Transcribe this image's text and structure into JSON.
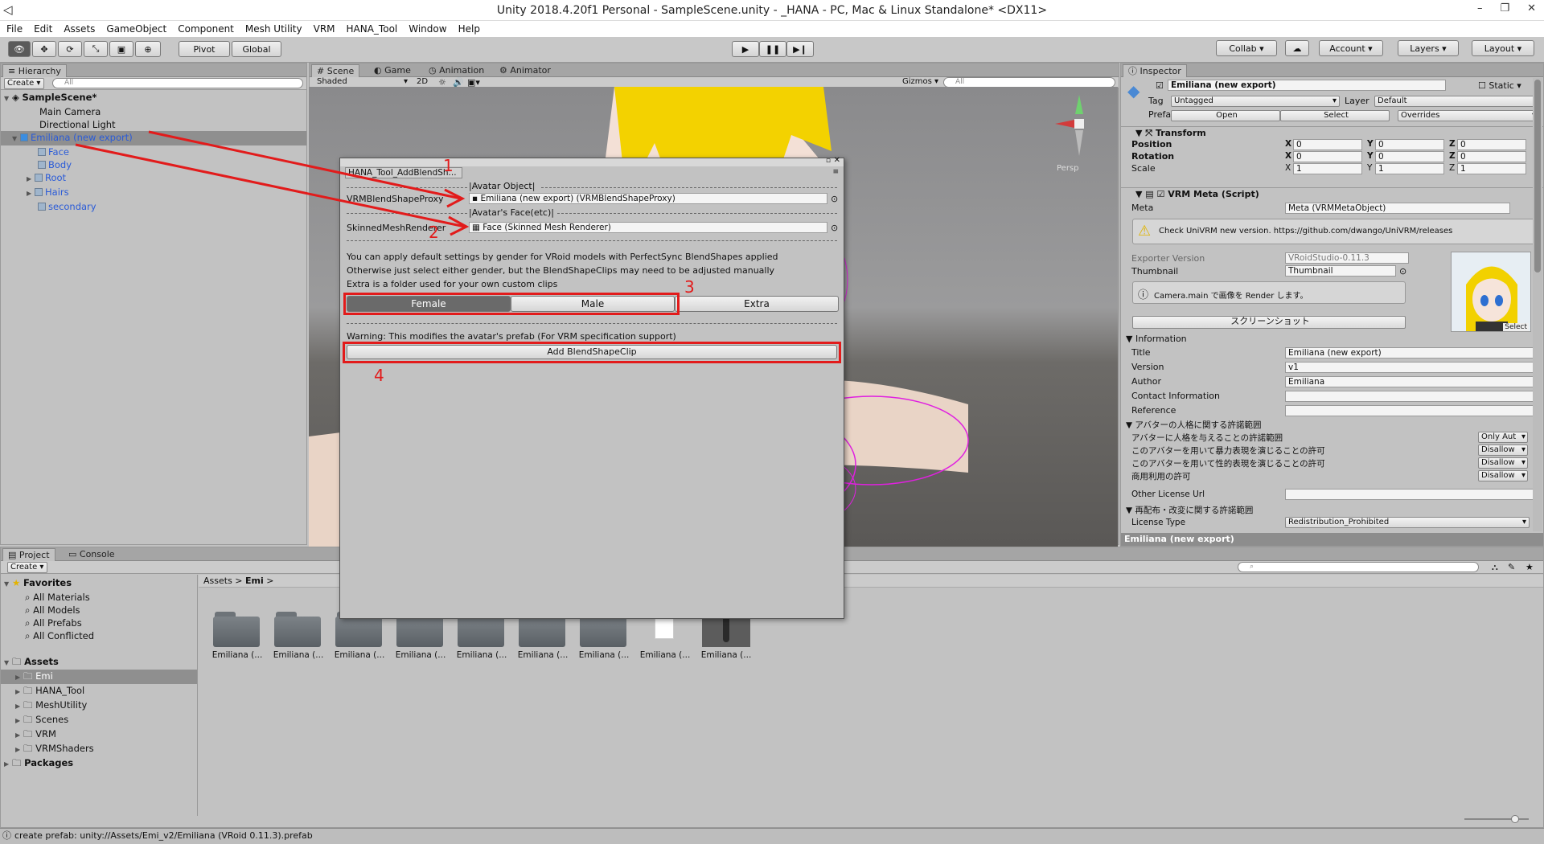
{
  "window": {
    "title": "Unity 2018.4.20f1 Personal - SampleScene.unity - _HANA - PC, Mac & Linux Standalone* <DX11>",
    "min": "–",
    "max": "❐",
    "close": "✕"
  },
  "menu": [
    "File",
    "Edit",
    "Assets",
    "GameObject",
    "Component",
    "Mesh Utility",
    "VRM",
    "HANA_Tool",
    "Window",
    "Help"
  ],
  "toolbar": {
    "pivot": "Pivot",
    "global": "Global",
    "collab": "Collab",
    "account": "Account",
    "layers": "Layers",
    "layout": "Layout"
  },
  "hierarchy": {
    "tab": "Hierarchy",
    "create": "Create",
    "search_placeholder": "All",
    "scene": "SampleScene*",
    "items": [
      {
        "label": "Main Camera",
        "indent": 1
      },
      {
        "label": "Directional Light",
        "indent": 1
      },
      {
        "label": "Emiliana (new export)",
        "indent": 1
      },
      {
        "label": "Face",
        "indent": 2
      },
      {
        "label": "Body",
        "indent": 2
      },
      {
        "label": "Root",
        "indent": 2
      },
      {
        "label": "Hairs",
        "indent": 2
      },
      {
        "label": "secondary",
        "indent": 2
      }
    ]
  },
  "scene_view": {
    "tabs": [
      "Scene",
      "Game",
      "Animation",
      "Animator"
    ],
    "shading": "Shaded",
    "mode2d": "2D",
    "gizmos": "Gizmos",
    "search_placeholder": "All",
    "persp": "Persp"
  },
  "dialog": {
    "title": "HANA_Tool_AddBlendSh...",
    "avatar_object": "|Avatar Object|",
    "proxy_label": "VRMBlendShapeProxy",
    "proxy_value": "Emiliana (new export) (VRMBlendShapeProxy)",
    "face_header": "|Avatar's Face(etc)|",
    "smr_label": "SkinnedMeshRenderer",
    "smr_value": "Face (Skinned Mesh Renderer)",
    "info1": "You can apply default settings by gender for VRoid models with PerfectSync BlendShapes applied",
    "info2": "Otherwise just select either gender, but the BlendShapeClips may need to be adjusted manually",
    "info3": "Extra is a folder used for your own custom clips",
    "gender": [
      "Female",
      "Male",
      "Extra"
    ],
    "warning": "Warning: This modifies the avatar's prefab (For VRM specification support)",
    "add_button": "Add BlendShapeClip",
    "annotations": [
      "1",
      "2",
      "3",
      "4"
    ]
  },
  "inspector": {
    "tab": "Inspector",
    "object_name": "Emiliana (new export)",
    "static": "Static",
    "tag_label": "Tag",
    "tag_value": "Untagged",
    "layer_label": "Layer",
    "layer_value": "Default",
    "prefab_label": "Prefab",
    "prefab_open": "Open",
    "prefab_select": "Select",
    "prefab_overrides": "Overrides",
    "transform": {
      "title": "Transform",
      "rows": [
        {
          "label": "Position",
          "x": "0",
          "y": "0",
          "z": "0"
        },
        {
          "label": "Rotation",
          "x": "0",
          "y": "0",
          "z": "0"
        },
        {
          "label": "Scale",
          "x": "1",
          "y": "1",
          "z": "1"
        }
      ]
    },
    "vrm_meta": {
      "title": "VRM Meta (Script)",
      "meta_label": "Meta",
      "meta_value": "Meta (VRMMetaObject)",
      "warn": "Check UniVRM new version. https://github.com/dwango/UniVRM/releases",
      "exporter_label": "Exporter Version",
      "exporter_value": "VRoidStudio-0.11.3",
      "thumb_label": "Thumbnail",
      "thumb_value": "Thumbnail",
      "camera_note": "Camera.main で画像を Render します。",
      "screenshot": "スクリーンショット",
      "select": "Select"
    },
    "information": {
      "title": "Information",
      "rows": [
        {
          "label": "Title",
          "value": "Emiliana (new export)"
        },
        {
          "label": "Version",
          "value": "v1"
        },
        {
          "label": "Author",
          "value": "Emiliana"
        },
        {
          "label": "Contact Information",
          "value": ""
        },
        {
          "label": "Reference",
          "value": ""
        }
      ]
    },
    "license_persona": {
      "title": "アバターの人格に関する許諾範囲",
      "rows": [
        {
          "label": "アバターに人格を与えることの許諾範囲",
          "value": "Only Aut"
        },
        {
          "label": "このアバターを用いて暴力表現を演じることの許可",
          "value": "Disallow"
        },
        {
          "label": "このアバターを用いて性的表現を演じることの許可",
          "value": "Disallow"
        },
        {
          "label": "商用利用の許可",
          "value": "Disallow"
        }
      ]
    },
    "other_license": "Other License Url",
    "redistribution": {
      "title": "再配布・改変に関する許諾範囲",
      "label": "License Type",
      "value": "Redistribution_Prohibited"
    },
    "footer": "Emiliana (new export)"
  },
  "project": {
    "tabs": [
      "Project",
      "Console"
    ],
    "create": "Create",
    "favorites": {
      "title": "Favorites",
      "items": [
        "All Materials",
        "All Models",
        "All Prefabs",
        "All Conflicted"
      ]
    },
    "assets": {
      "title": "Assets",
      "items": [
        "Emi",
        "HANA_Tool",
        "MeshUtility",
        "Scenes",
        "VRM",
        "VRMShaders"
      ]
    },
    "packages": "Packages",
    "breadcrumb": [
      "Assets",
      "Emi"
    ],
    "files": [
      "Emiliana (...",
      "Emiliana (...",
      "Emiliana (...",
      "Emiliana (...",
      "Emiliana (...",
      "Emiliana (...",
      "Emiliana (...",
      "Emiliana (...",
      "Emiliana (..."
    ]
  },
  "status": "create prefab: unity://Assets/Emi_v2/Emiliana (VRoid 0.11.3).prefab"
}
